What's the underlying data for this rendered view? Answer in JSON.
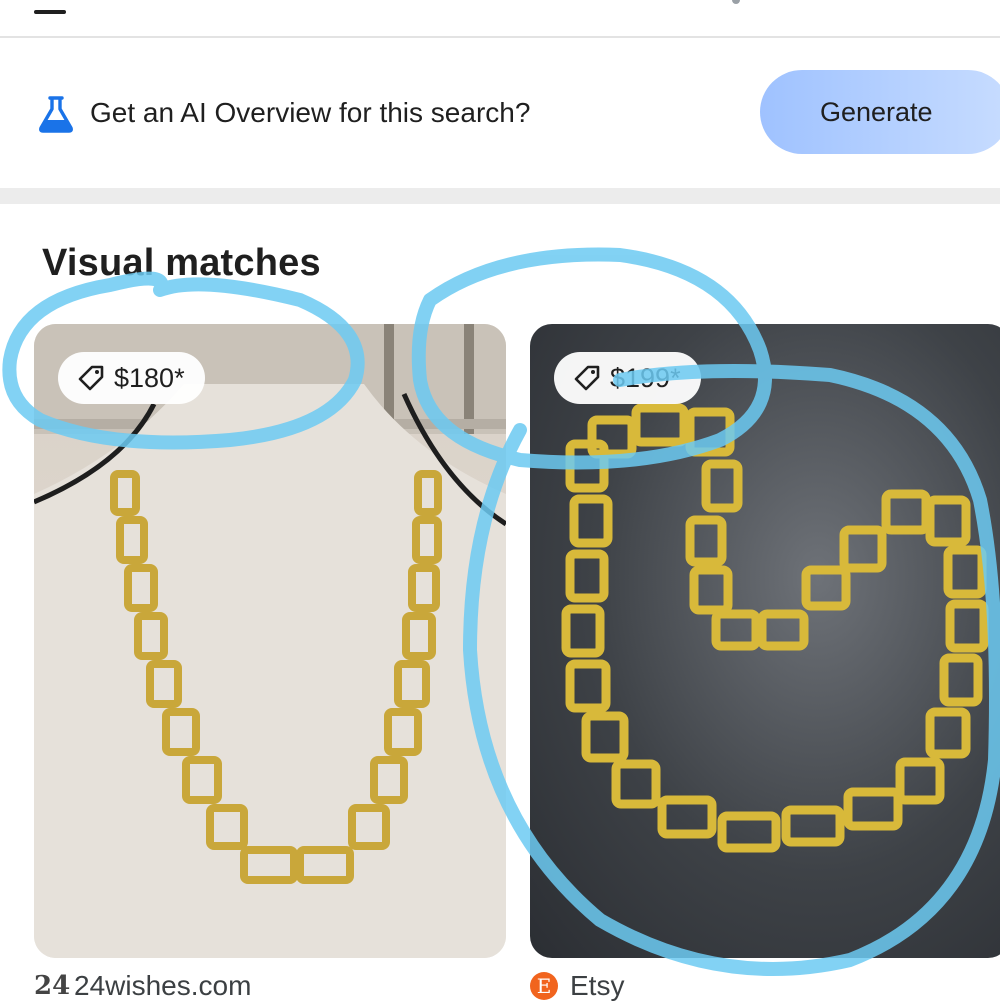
{
  "ai_overview": {
    "prompt_text": "Get an AI Overview for this search?",
    "generate_label": "Generate",
    "icon": "flask-icon"
  },
  "visual_matches": {
    "title": "Visual matches",
    "items": [
      {
        "price": "$180*",
        "source": "24wishes.com",
        "source_icon": "24wishes-favicon",
        "favicon_text": "24"
      },
      {
        "price": "$199*",
        "source": "Etsy",
        "source_icon": "etsy-favicon",
        "favicon_text": "E"
      }
    ]
  },
  "colors": {
    "generate_button": "#9fc2ff",
    "annotation_stroke": "#6ccaf2",
    "etsy": "#f1641e"
  }
}
